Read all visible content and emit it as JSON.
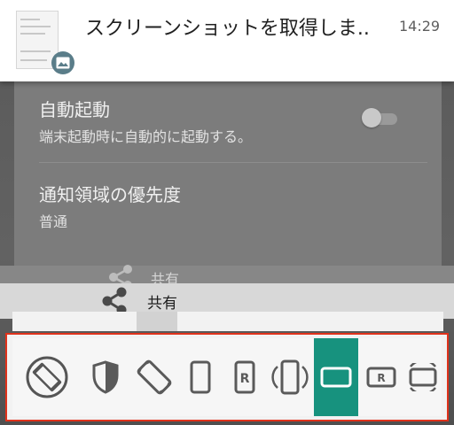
{
  "notification": {
    "title": "スクリーンショットを取得しま..",
    "time": "14:29"
  },
  "settings": {
    "auto_start": {
      "title": "自動起動",
      "subtitle": "端末起動時に自動的に起動する。",
      "toggle_on": false
    },
    "notification_priority": {
      "title": "通知領域の優先度",
      "value": "普通"
    }
  },
  "share": {
    "label": "共有",
    "ghost_label": "共有"
  },
  "toolbar": {
    "active_index": 7,
    "items": [
      {
        "icon": "auto-rotate-icon"
      },
      {
        "icon": "shield-icon"
      },
      {
        "icon": "rotate-icon"
      },
      {
        "icon": "portrait-icon"
      },
      {
        "icon": "reverse-portrait-icon"
      },
      {
        "icon": "portrait-sensor-icon"
      },
      {
        "icon": "landscape-icon"
      },
      {
        "icon": "reverse-landscape-icon"
      },
      {
        "icon": "landscape-sensor-icon"
      }
    ]
  },
  "colors": {
    "accent": "#17927e",
    "highlight_border": "#e0321b"
  }
}
